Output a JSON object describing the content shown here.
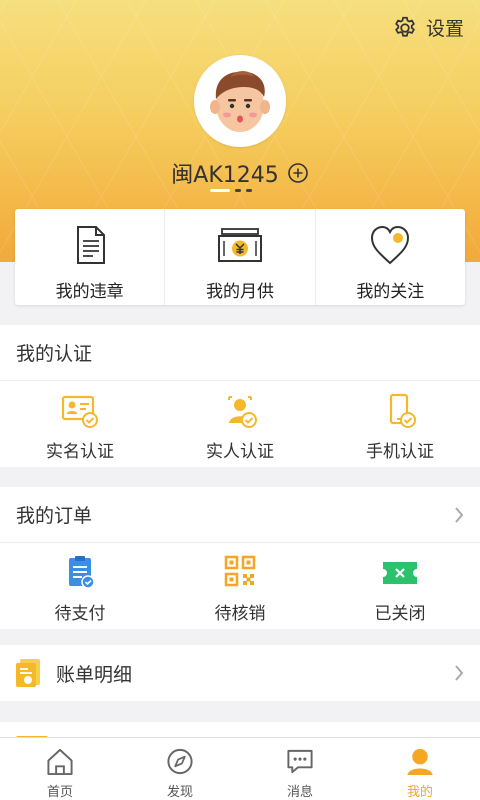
{
  "header": {
    "settings_label": "设置",
    "plate_number": "闽AK1245",
    "colors": {
      "gradient_top": "#f6df7e",
      "gradient_bottom": "#f2a93a"
    }
  },
  "quick_card": {
    "items": [
      {
        "label": "我的违章",
        "icon": "document-icon"
      },
      {
        "label": "我的月供",
        "icon": "money-stack-icon"
      },
      {
        "label": "我的关注",
        "icon": "heart-icon"
      }
    ]
  },
  "certification": {
    "title": "我的认证",
    "items": [
      {
        "label": "实名认证",
        "icon": "id-card-verified-icon"
      },
      {
        "label": "实人认证",
        "icon": "person-verified-icon"
      },
      {
        "label": "手机认证",
        "icon": "phone-verified-icon"
      }
    ]
  },
  "orders": {
    "title": "我的订单",
    "items": [
      {
        "label": "待支付",
        "icon": "clipboard-icon"
      },
      {
        "label": "待核销",
        "icon": "qr-code-icon"
      },
      {
        "label": "已关闭",
        "icon": "ticket-closed-icon"
      }
    ]
  },
  "bill": {
    "label": "账单明细",
    "icon": "bill-icon"
  },
  "tabbar": {
    "items": [
      {
        "label": "首页",
        "icon": "home-icon"
      },
      {
        "label": "发现",
        "icon": "compass-icon"
      },
      {
        "label": "消息",
        "icon": "chat-icon"
      },
      {
        "label": "我的",
        "icon": "user-icon",
        "active": true
      }
    ],
    "active_color": "#f5a623"
  },
  "accent": "#f5b82a"
}
